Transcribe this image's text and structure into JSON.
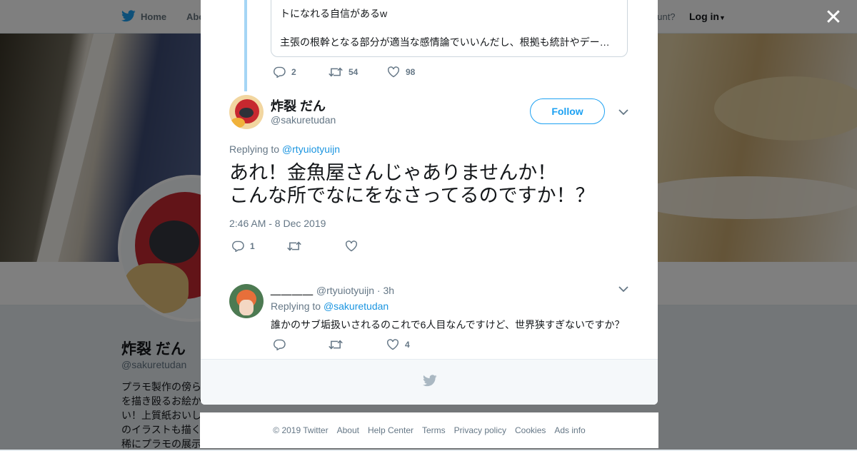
{
  "nav": {
    "home": "Home",
    "about": "Abo",
    "account_prompt": "ccount?",
    "login": "Log in"
  },
  "profile": {
    "name": "炸裂 だん",
    "handle": "@sakuretudan",
    "bio_lines": [
      "プラモ製作の傍ら",
      "を描き殴るお絵か",
      "い！上質紙おいし",
      "のイラストも描く",
      "稀にプラモの展示"
    ]
  },
  "quoted_tweet": {
    "line1": "トになれる自信があるw",
    "line2": "主張の根幹となる部分が適当な感情論でいいんだし、根拠も統計やデー…"
  },
  "parent_actions": {
    "replies": "2",
    "retweets": "54",
    "likes": "98"
  },
  "main_tweet": {
    "name": "炸裂 だん",
    "handle": "@sakuretudan",
    "follow_label": "Follow",
    "replying_prefix": "Replying to",
    "replying_to": "@rtyuiotyuijn",
    "text_line1": "あれ！金魚屋さんじゃありませんか！",
    "text_line2": "こんな所でなにをなさってるのですか！？",
    "timestamp": "2:46 AM - 8 Dec 2019",
    "replies": "1",
    "retweets": "",
    "likes": ""
  },
  "reply_tweet": {
    "name": "＿＿＿＿",
    "handle": "@rtyuiotyuijn",
    "time": "· 3h",
    "replying_prefix": "Replying to",
    "replying_to": "@sakuretudan",
    "text": "誰かのサブ垢扱いされるのこれで6人目なんですけど、世界狭すぎないですか？",
    "replies": "",
    "retweets": "",
    "likes": "4"
  },
  "footer": {
    "copyright": "© 2019 Twitter",
    "about": "About",
    "help": "Help Center",
    "terms": "Terms",
    "privacy": "Privacy policy",
    "cookies": "Cookies",
    "ads": "Ads info"
  },
  "colors": {
    "brand": "#1da1f2",
    "link": "#1b95e0",
    "muted": "#657786"
  },
  "icons": [
    "twitter-bird-icon",
    "close-icon",
    "reply-icon",
    "retweet-icon",
    "like-icon",
    "chevron-down-icon"
  ]
}
